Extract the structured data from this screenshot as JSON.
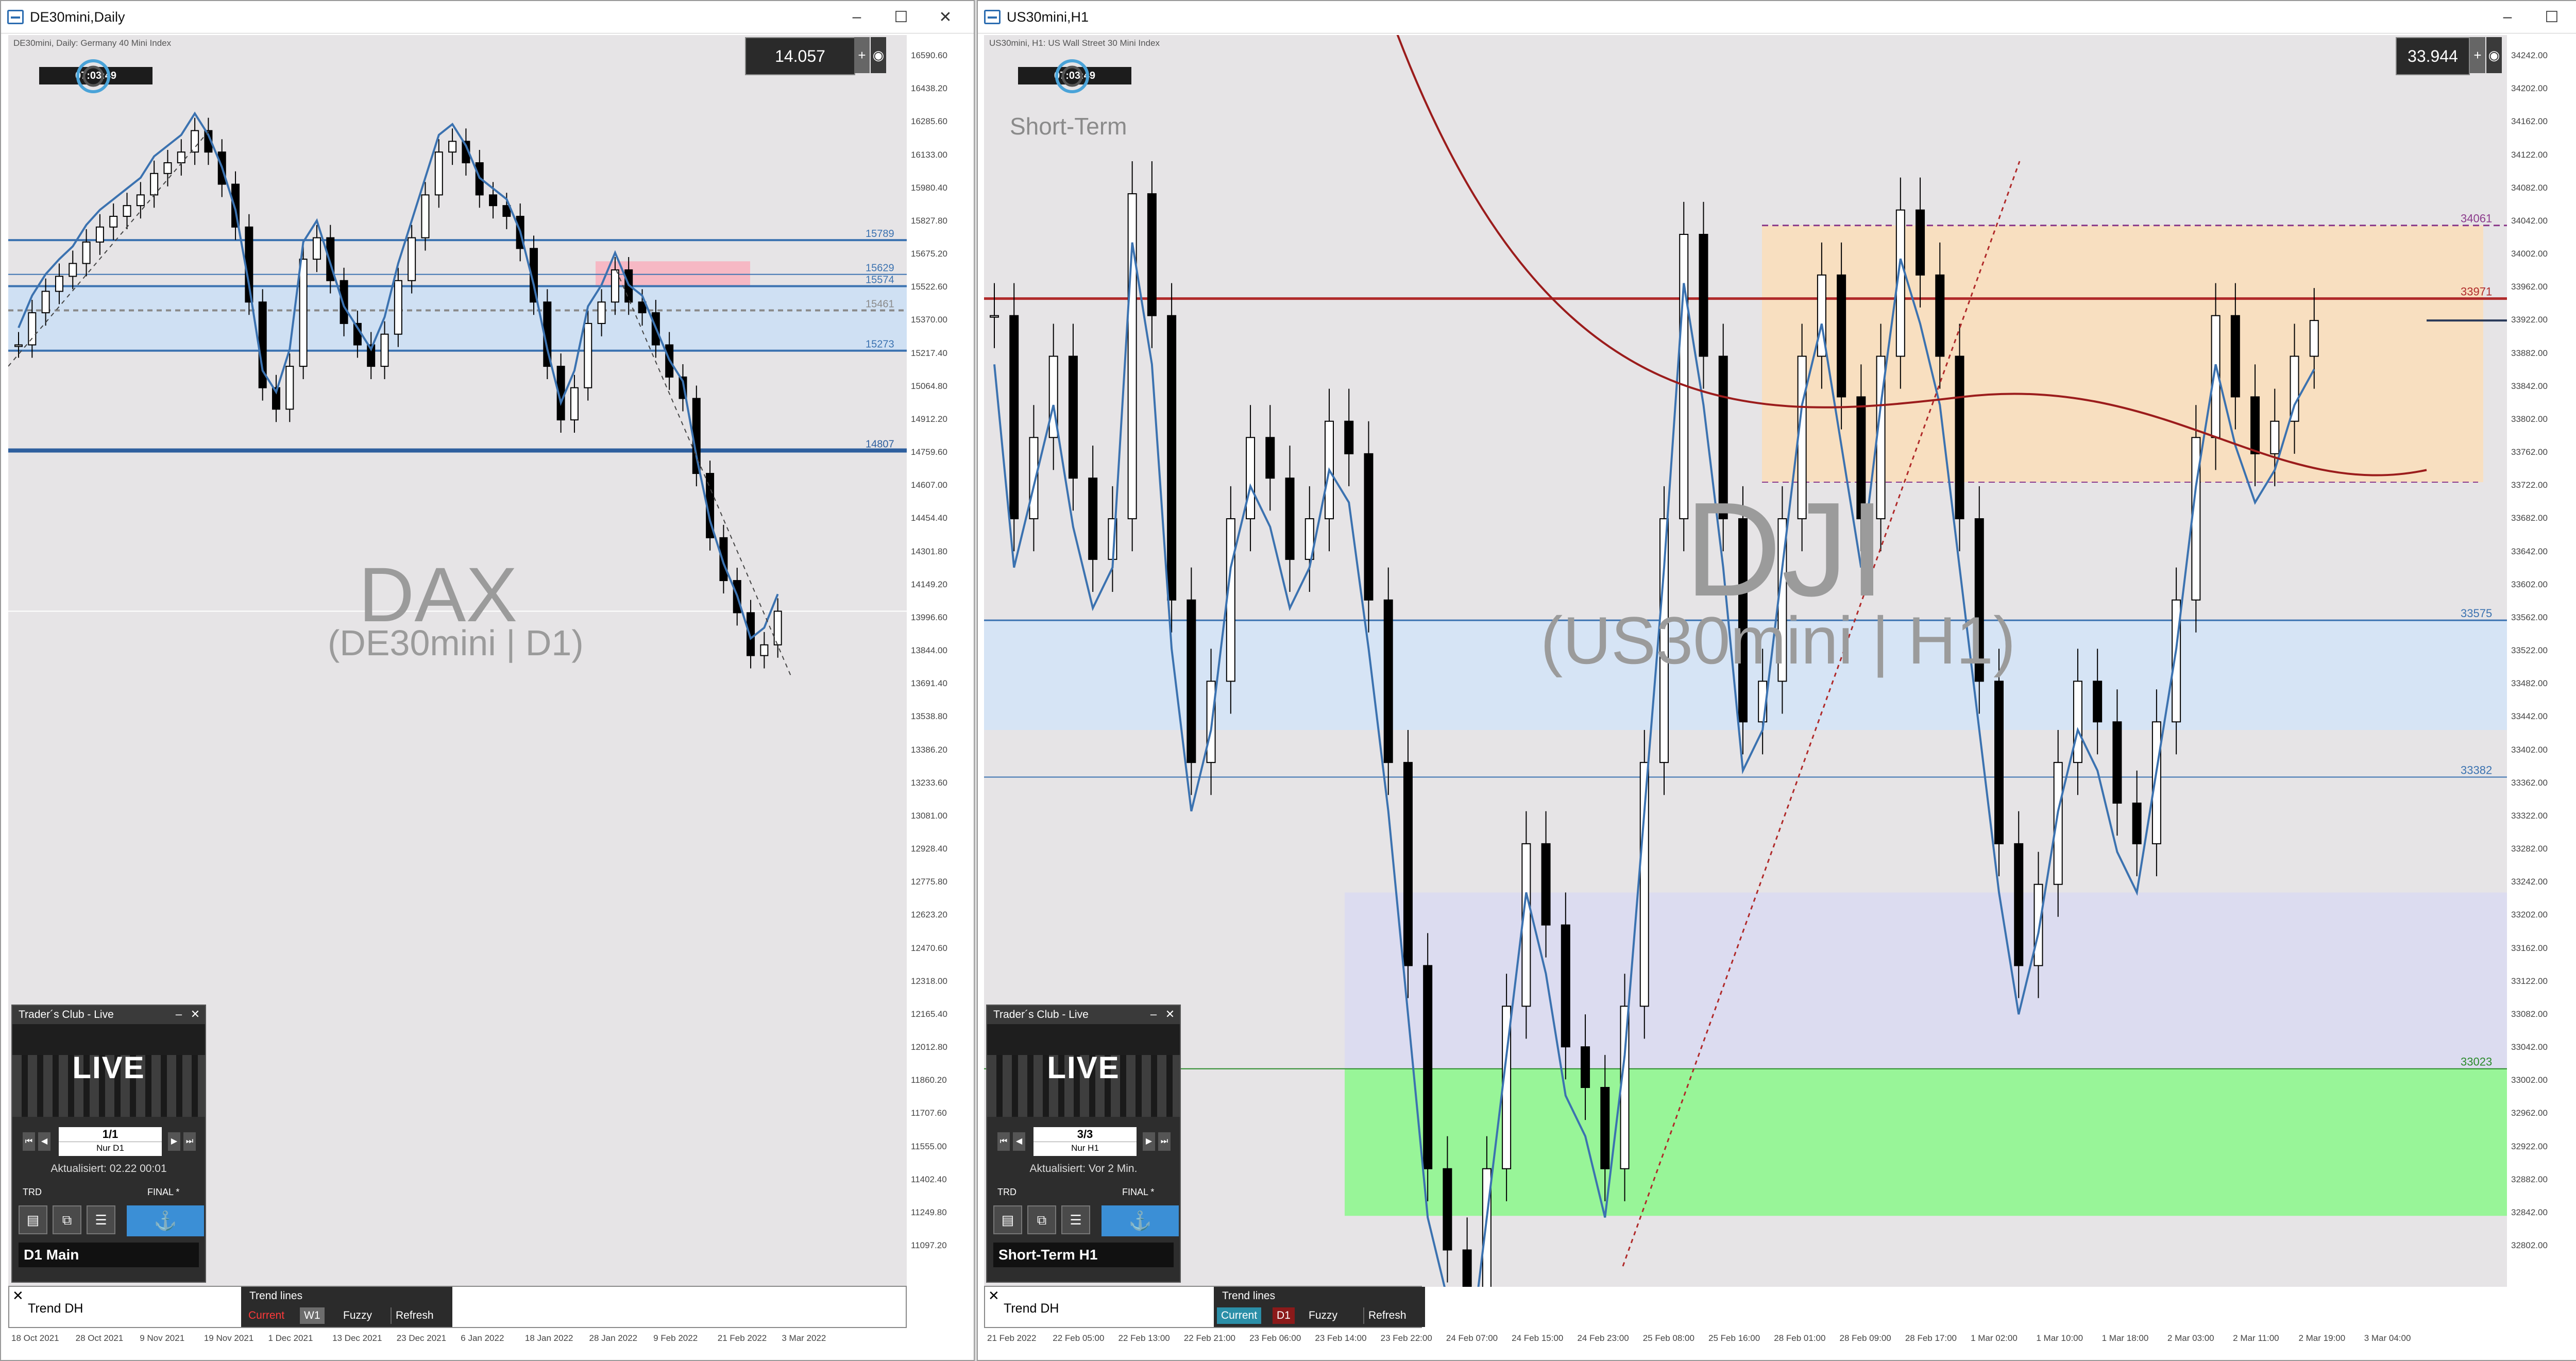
{
  "left_window": {
    "title": "DE30mini,Daily",
    "subtitle": "DE30mini, Daily:  Germany 40 Mini Index",
    "clock": "07:03:49",
    "price": "14.057",
    "watermark_main": "DAX",
    "watermark_sub": "(DE30mini | D1)",
    "levels": [
      {
        "label": "15789",
        "price": 15789,
        "color": "#3b72b0",
        "style": "solid"
      },
      {
        "label": "15629",
        "price": 15629,
        "color": "#3b72b0",
        "style": "thin"
      },
      {
        "label": "15574",
        "price": 15574,
        "color": "#3b72b0",
        "style": "solid"
      },
      {
        "label": "15461",
        "price": 15461,
        "color": "#8a8a8a",
        "style": "dashed"
      },
      {
        "label": "15273",
        "price": 15273,
        "color": "#3b72b0",
        "style": "solid"
      },
      {
        "label": "14807",
        "price": 14807,
        "color": "#2e5f9e",
        "style": "thick"
      }
    ],
    "y_axis": [
      "16590.60",
      "16438.20",
      "16285.60",
      "16133.00",
      "15980.40",
      "15827.80",
      "15675.20",
      "15522.60",
      "15370.00",
      "15217.40",
      "15064.80",
      "14912.20",
      "14759.60",
      "14607.00",
      "14454.40",
      "14301.80",
      "14149.20",
      "13996.60",
      "13844.00",
      "13691.40",
      "13538.80",
      "13386.20",
      "13233.60",
      "13081.00",
      "12928.40",
      "12775.80",
      "12623.20",
      "12470.60",
      "12318.00",
      "12165.40",
      "12012.80",
      "11860.20",
      "11707.60",
      "11555.00",
      "11402.40",
      "11249.80",
      "11097.20"
    ],
    "x_axis": [
      "18 Oct 2021",
      "28 Oct 2021",
      "9 Nov 2021",
      "19 Nov 2021",
      "1 Dec 2021",
      "13 Dec 2021",
      "23 Dec 2021",
      "6 Jan 2022",
      "18 Jan 2022",
      "28 Jan 2022",
      "9 Feb 2022",
      "21 Feb 2022",
      "3 Mar 2022"
    ],
    "panel": {
      "title": "Trader´s Club - Live",
      "live_text": "LIVE",
      "page": "1/1",
      "page_label": "Nur D1",
      "updated": "Aktualisiert: 02.22 00:01",
      "trd": "TRD",
      "final": "FINAL *",
      "label": "D1 Main"
    },
    "bottombar": {
      "close": "✕",
      "trend": "Trend DH",
      "trendlines_title": "Trend lines",
      "buttons": [
        {
          "label": "Current",
          "bg": "#2b2b2b",
          "fg": "#ff3a3a"
        },
        {
          "label": "W1",
          "bg": "#6d6d6d",
          "fg": "#ffffff"
        },
        {
          "label": "Fuzzy",
          "bg": "#2b2b2b",
          "fg": "#ffffff"
        },
        {
          "label": "Refresh",
          "bg": "#2b2b2b",
          "fg": "#ffffff"
        }
      ]
    }
  },
  "right_window": {
    "title": "US30mini,H1",
    "subtitle": "US30mini, H1:  US Wall Street 30 Mini Index",
    "clock": "07:03:49",
    "price": "33.944",
    "short_term": "Short-Term",
    "watermark_main": "DJI",
    "watermark_sub": "(US30mini | H1)",
    "levels": [
      {
        "label": "34061",
        "price": 34061,
        "color": "#8b3a8b",
        "style": "dashed"
      },
      {
        "label": "33971",
        "price": 33971,
        "color": "#b02a2a",
        "style": "thick"
      },
      {
        "label": "33575",
        "price": 33575,
        "color": "#3b72b0",
        "style": "solid"
      },
      {
        "label": "33382",
        "price": 33382,
        "color": "#3b72b0",
        "style": "thin"
      },
      {
        "label": "33023",
        "price": 33023,
        "color": "#2a8a2a",
        "style": "thin"
      }
    ],
    "y_axis": [
      "34242.00",
      "34202.00",
      "34162.00",
      "34122.00",
      "34082.00",
      "34042.00",
      "34002.00",
      "33962.00",
      "33922.00",
      "33882.00",
      "33842.00",
      "33802.00",
      "33762.00",
      "33722.00",
      "33682.00",
      "33642.00",
      "33602.00",
      "33562.00",
      "33522.00",
      "33482.00",
      "33442.00",
      "33402.00",
      "33362.00",
      "33322.00",
      "33282.00",
      "33242.00",
      "33202.00",
      "33162.00",
      "33122.00",
      "33082.00",
      "33042.00",
      "33002.00",
      "32962.00",
      "32922.00",
      "32882.00",
      "32842.00",
      "32802.00"
    ],
    "x_axis": [
      "21 Feb 2022",
      "22 Feb 05:00",
      "22 Feb 13:00",
      "22 Feb 21:00",
      "23 Feb 06:00",
      "23 Feb 14:00",
      "23 Feb 22:00",
      "24 Feb 07:00",
      "24 Feb 15:00",
      "24 Feb 23:00",
      "25 Feb 08:00",
      "25 Feb 16:00",
      "28 Feb 01:00",
      "28 Feb 09:00",
      "28 Feb 17:00",
      "1 Mar 02:00",
      "1 Mar 10:00",
      "1 Mar 18:00",
      "2 Mar 03:00",
      "2 Mar 11:00",
      "2 Mar 19:00",
      "3 Mar 04:00"
    ],
    "panel": {
      "title": "Trader´s Club - Live",
      "live_text": "LIVE",
      "page": "3/3",
      "page_label": "Nur H1",
      "updated": "Aktualisiert: Vor 2 Min.",
      "trd": "TRD",
      "final": "FINAL *",
      "label": "Short-Term H1"
    },
    "bottombar": {
      "close": "✕",
      "trend": "Trend DH",
      "trendlines_title": "Trend lines",
      "buttons": [
        {
          "label": "Current",
          "bg": "#2b8fa8",
          "fg": "#ffffff"
        },
        {
          "label": "D1",
          "bg": "#8b1a1a",
          "fg": "#ffffff"
        },
        {
          "label": "Fuzzy",
          "bg": "#2b2b2b",
          "fg": "#ffffff"
        },
        {
          "label": "Refresh",
          "bg": "#2b2b2b",
          "fg": "#ffffff"
        }
      ]
    }
  },
  "window_buttons": {
    "minimize": "–",
    "maximize": "☐",
    "close": "✕"
  }
}
